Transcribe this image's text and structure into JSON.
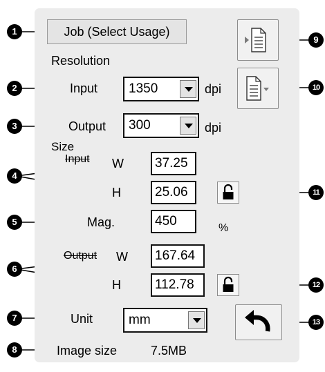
{
  "job": {
    "label": "Job (Select Usage)"
  },
  "resolution": {
    "heading": "Resolution",
    "input_label": "Input",
    "input_value": "1350",
    "output_label": "Output",
    "output_value": "300",
    "unit": "dpi"
  },
  "size": {
    "heading": "Size",
    "input_label": "Input",
    "output_label": "Output",
    "w_label": "W",
    "h_label": "H",
    "input_w": "37.25",
    "input_h": "25.06",
    "output_w": "167.64",
    "output_h": "112.78"
  },
  "mag": {
    "label": "Mag.",
    "value": "450",
    "unit": "%"
  },
  "unit": {
    "label": "Unit",
    "value": "mm"
  },
  "image_size": {
    "label": "Image size",
    "value": "7.5MB"
  },
  "callouts": [
    "1",
    "2",
    "3",
    "4",
    "5",
    "6",
    "7",
    "8",
    "9",
    "10",
    "11",
    "12",
    "13"
  ],
  "icons": {
    "save_settings": "page-arrow-in-icon",
    "load_settings": "page-dropdown-icon",
    "input_lock": "lock-icon",
    "output_lock": "lock-icon",
    "reset": "undo-arrow-icon"
  }
}
